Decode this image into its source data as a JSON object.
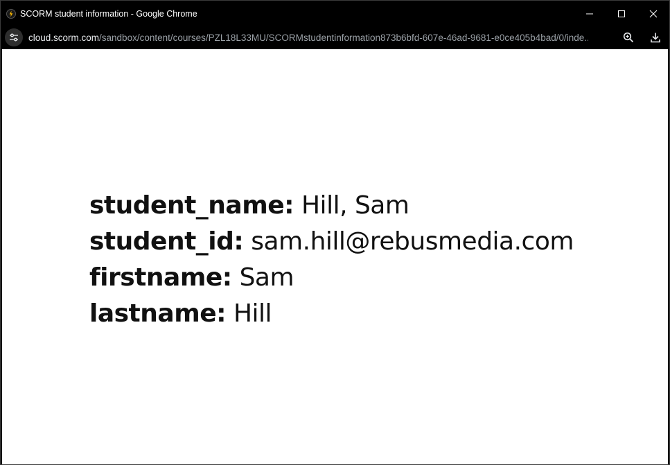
{
  "window": {
    "title": "SCORM student information - Google Chrome"
  },
  "addressbar": {
    "url_domain": "cloud.scorm.com",
    "url_path": "/sandbox/content/courses/PZL18L33MU/SCORMstudentinformation873b6bfd-607e-46ad-9681-e0ce405b4bad/0/inde..."
  },
  "icons": {
    "favicon": "scorm-favicon-icon",
    "site_info": "tune-icon",
    "zoom": "zoom-in-icon",
    "download": "download-icon",
    "minimize": "minimize-icon",
    "maximize": "maximize-icon",
    "close": "close-icon"
  },
  "student": {
    "rows": [
      {
        "label": "student_name:",
        "value": " Hill, Sam"
      },
      {
        "label": "student_id:",
        "value": " sam.hill@rebusmedia.com"
      },
      {
        "label": "firstname:",
        "value": " Sam"
      },
      {
        "label": "lastname:",
        "value": " Hill"
      }
    ]
  }
}
